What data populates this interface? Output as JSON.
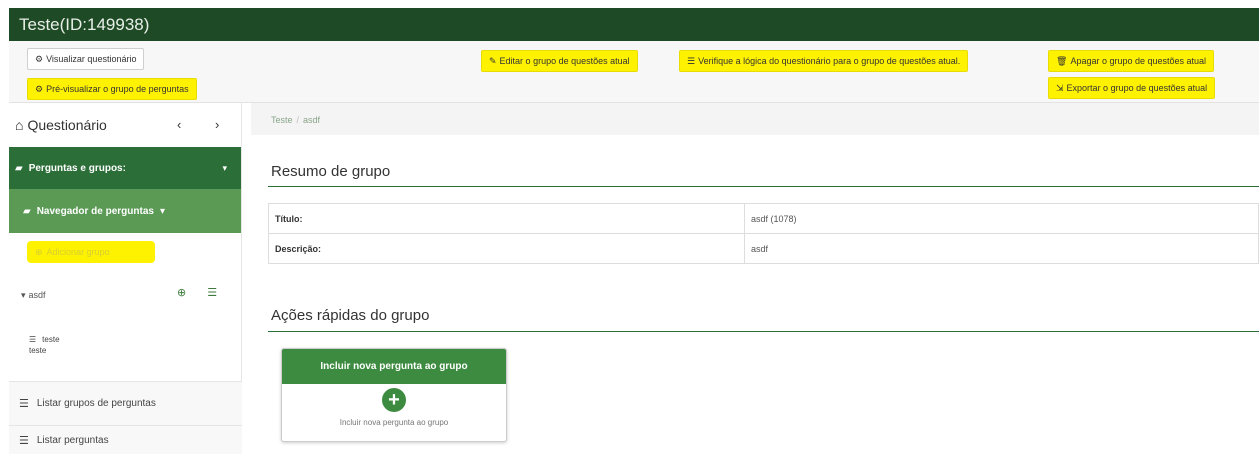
{
  "titlebar": {
    "title": "Teste(ID:149938)"
  },
  "toolbar": {
    "preview_survey": "Visualizar questionário",
    "preview_group": "Pré-visualizar o grupo de perguntas",
    "edit_group": "Editar o grupo de questões atual",
    "check_logic": "Verifique a lógica do questionário para o grupo de questões atual.",
    "delete_group": "Apagar o grupo de questões atual",
    "export_group": "Exportar o grupo de questões atual",
    "highlight_color": "#fff200"
  },
  "sidebar": {
    "title": "Questionário",
    "groups_label": "Perguntas e grupos:",
    "navigator_label": "Navegador de perguntas",
    "add_group_label": "Adicionar grupo",
    "group_name": "asdf",
    "question_code": "teste",
    "question_text": "teste",
    "list_groups": "Listar grupos de perguntas",
    "list_questions": "Listar perguntas",
    "accent": "#2c6e38"
  },
  "breadcrumb": {
    "root": "Teste",
    "current": "asdf"
  },
  "summary": {
    "heading": "Resumo de grupo",
    "rows": [
      {
        "key": "Título:",
        "value": "asdf (1078)"
      },
      {
        "key": "Descrição:",
        "value": "asdf"
      }
    ]
  },
  "quick_actions": {
    "heading": "Ações rápidas do grupo",
    "card_title": "Incluir nova pergunta ao grupo",
    "card_subtitle": "Incluir nova pergunta ao grupo"
  }
}
